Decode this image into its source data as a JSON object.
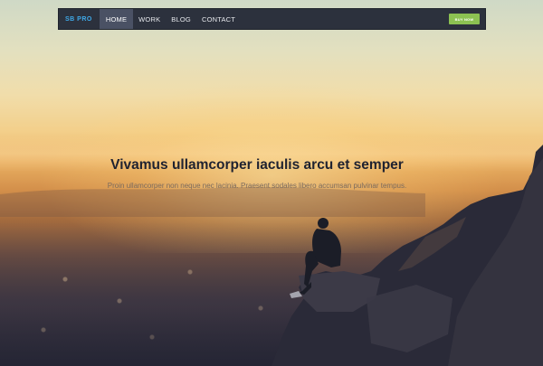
{
  "navbar": {
    "brand": "SB PRO",
    "items": [
      {
        "label": "HOME",
        "active": true
      },
      {
        "label": "WORK",
        "active": false
      },
      {
        "label": "BLOG",
        "active": false
      },
      {
        "label": "CONTACT",
        "active": false
      }
    ],
    "buy_label": "BUY NOW"
  },
  "hero": {
    "headline": "Vivamus ullamcorper iaculis arcu et semper",
    "subline": "Proin ullamcorper non neque nec lacinia. Praesent sodales libero accumsan pulvinar tempus."
  },
  "colors": {
    "navbar_bg": "#2c313d",
    "active_bg": "#4a5164",
    "brand": "#3fa9e8",
    "button": "#8cc152"
  }
}
